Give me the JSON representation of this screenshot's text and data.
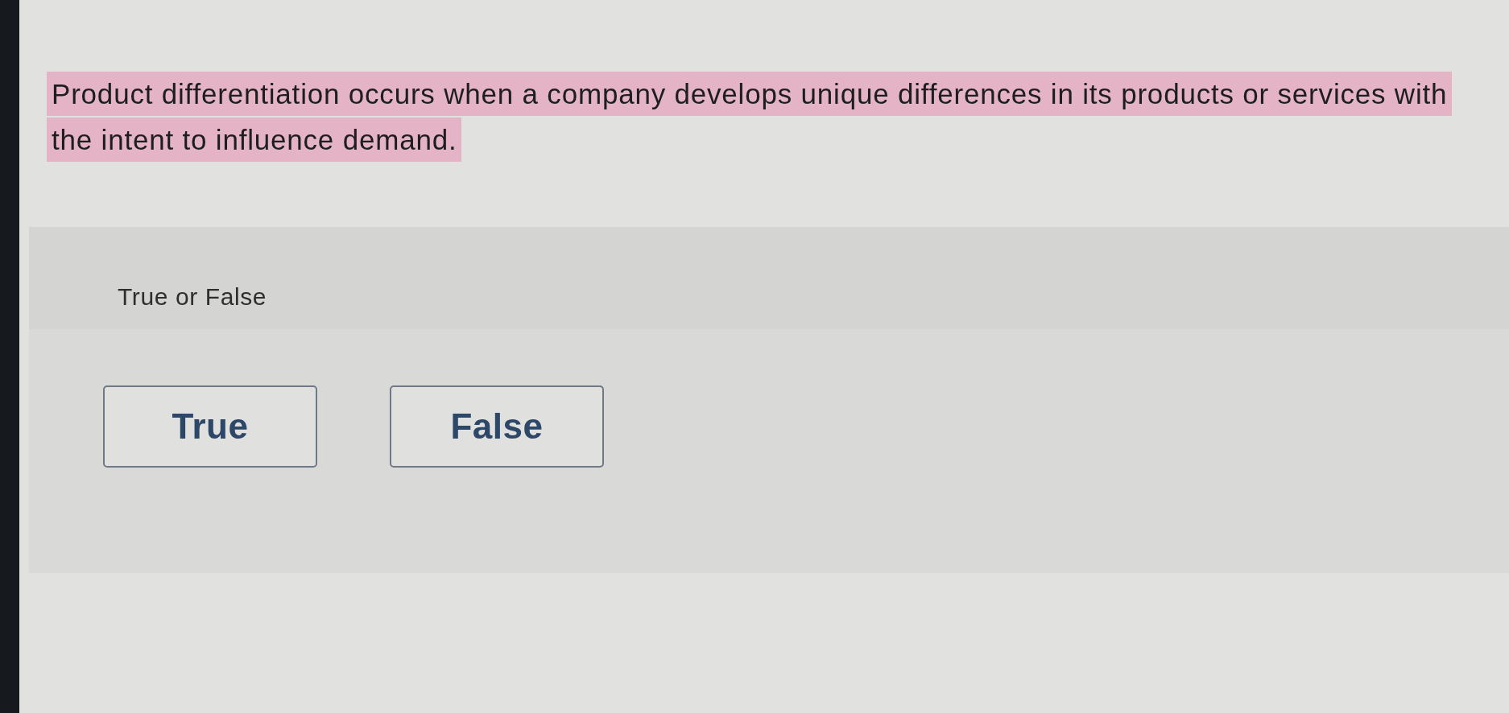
{
  "question": {
    "text": "Product differentiation occurs when a company develops unique differences in its products or services with the intent to influence demand.",
    "highlighted": true
  },
  "prompt": "True or False",
  "options": [
    {
      "label": "True",
      "selected": false
    },
    {
      "label": "False",
      "selected": false
    }
  ]
}
